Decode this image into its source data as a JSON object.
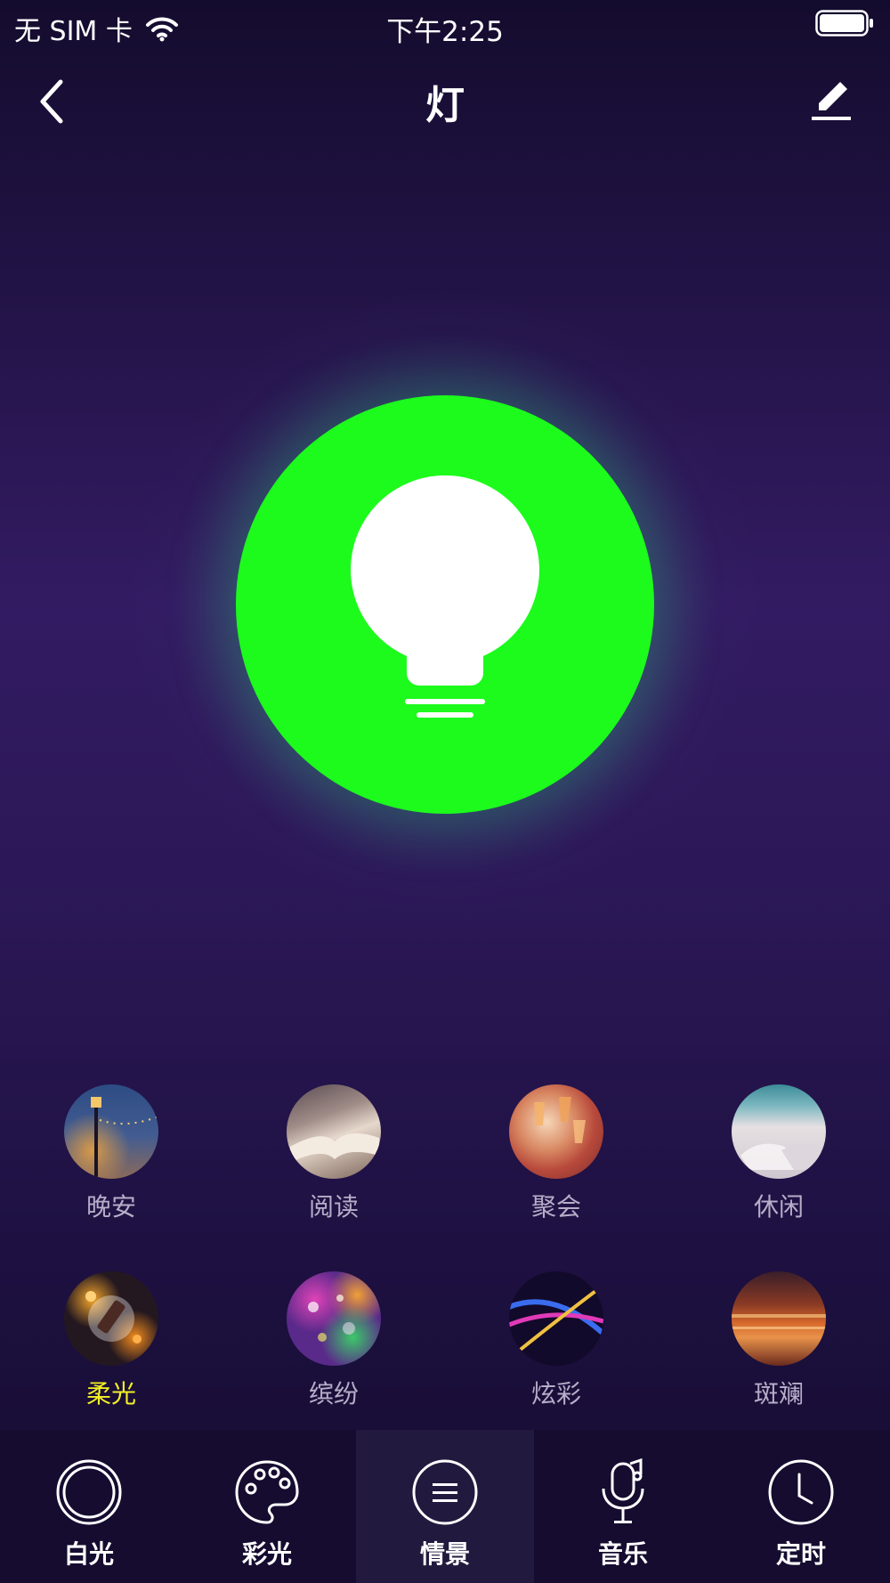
{
  "status_bar": {
    "carrier": "无 SIM 卡",
    "time": "下午2:25"
  },
  "nav": {
    "title": "灯"
  },
  "bulb": {
    "color": "#1cfb1c"
  },
  "scenes": [
    {
      "label": "晚安",
      "active": false
    },
    {
      "label": "阅读",
      "active": false
    },
    {
      "label": "聚会",
      "active": false
    },
    {
      "label": "休闲",
      "active": false
    },
    {
      "label": "柔光",
      "active": true
    },
    {
      "label": "缤纷",
      "active": false
    },
    {
      "label": "炫彩",
      "active": false
    },
    {
      "label": "斑斓",
      "active": false
    }
  ],
  "tabs": [
    {
      "label": "白光",
      "icon": "ring-icon"
    },
    {
      "label": "彩光",
      "icon": "palette-icon"
    },
    {
      "label": "情景",
      "icon": "menu-lines-icon",
      "active": true
    },
    {
      "label": "音乐",
      "icon": "microphone-icon"
    },
    {
      "label": "定时",
      "icon": "clock-icon"
    }
  ],
  "colors": {
    "active_scene_label": "#f3f025",
    "inactive_label": "#b7adc8"
  }
}
